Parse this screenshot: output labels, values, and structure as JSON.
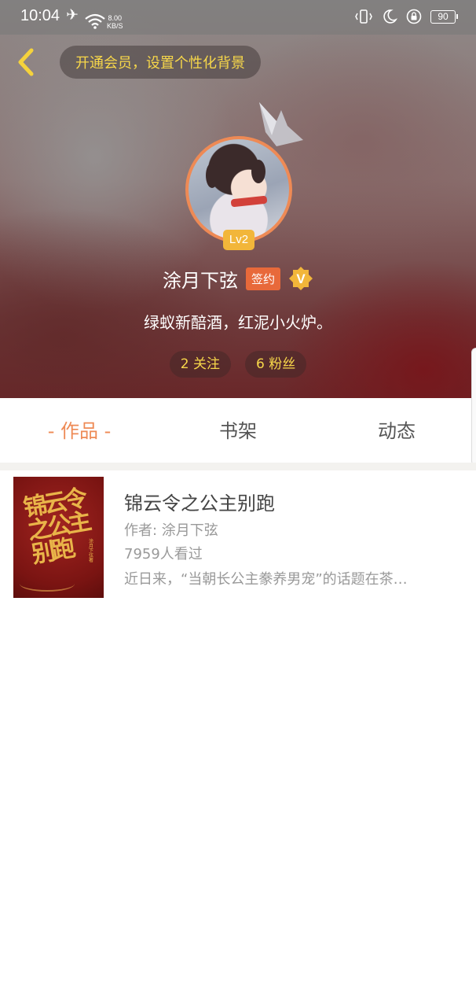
{
  "status_bar": {
    "time": "10:04",
    "network_speed_value": "8.00",
    "network_speed_unit": "KB/S",
    "battery": "90",
    "icons": [
      "airplane-icon",
      "wifi-icon",
      "vibrate-icon",
      "moon-icon",
      "lock-rotation-icon",
      "battery-icon"
    ]
  },
  "header": {
    "vip_prompt": "开通会员，设置个性化背景",
    "back_icon": "chevron-left-icon"
  },
  "profile": {
    "level": "Lv2",
    "name": "涂月下弦",
    "signed_badge": "签约",
    "verified_badge": "V",
    "bio": "绿蚁新醅酒，红泥小火炉。",
    "following": "2 关注",
    "followers": "6 粉丝"
  },
  "tabs": [
    {
      "label": "- 作品 -",
      "active": true
    },
    {
      "label": "书架",
      "active": false
    },
    {
      "label": "动态",
      "active": false
    }
  ],
  "books": [
    {
      "title": "锦云令之公主别跑",
      "author": "作者: 涂月下弦",
      "views": "7959人看过",
      "description": "近日来，“当朝长公主豢养男宠”的话题在茶…",
      "cover_title": "锦云令之公主别跑",
      "cover_author": "涂月下弦 著"
    }
  ],
  "colors": {
    "accent": "#ee8a55",
    "gold": "#f7d74a",
    "signed": "#e8693a",
    "level": "#f2b63a"
  }
}
